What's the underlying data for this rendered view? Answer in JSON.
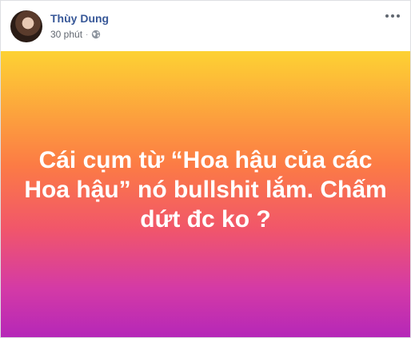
{
  "post": {
    "author": {
      "name": "Thùy Dung",
      "avatar_icon": "profile-photo"
    },
    "timestamp": "30 phút",
    "separator": "·",
    "privacy_icon": "globe-icon",
    "more_icon": "ellipsis-icon",
    "status_text": "Cái cụm từ “Hoa hậu của các Hoa hậu” nó bullshit lắm. Chấm dứt đc ko ?",
    "background_gradient": [
      "#fdd233",
      "#fc7b45",
      "#f1566a",
      "#d43aa6",
      "#b527b8"
    ],
    "text_color": "#ffffff",
    "name_color": "#385898"
  }
}
